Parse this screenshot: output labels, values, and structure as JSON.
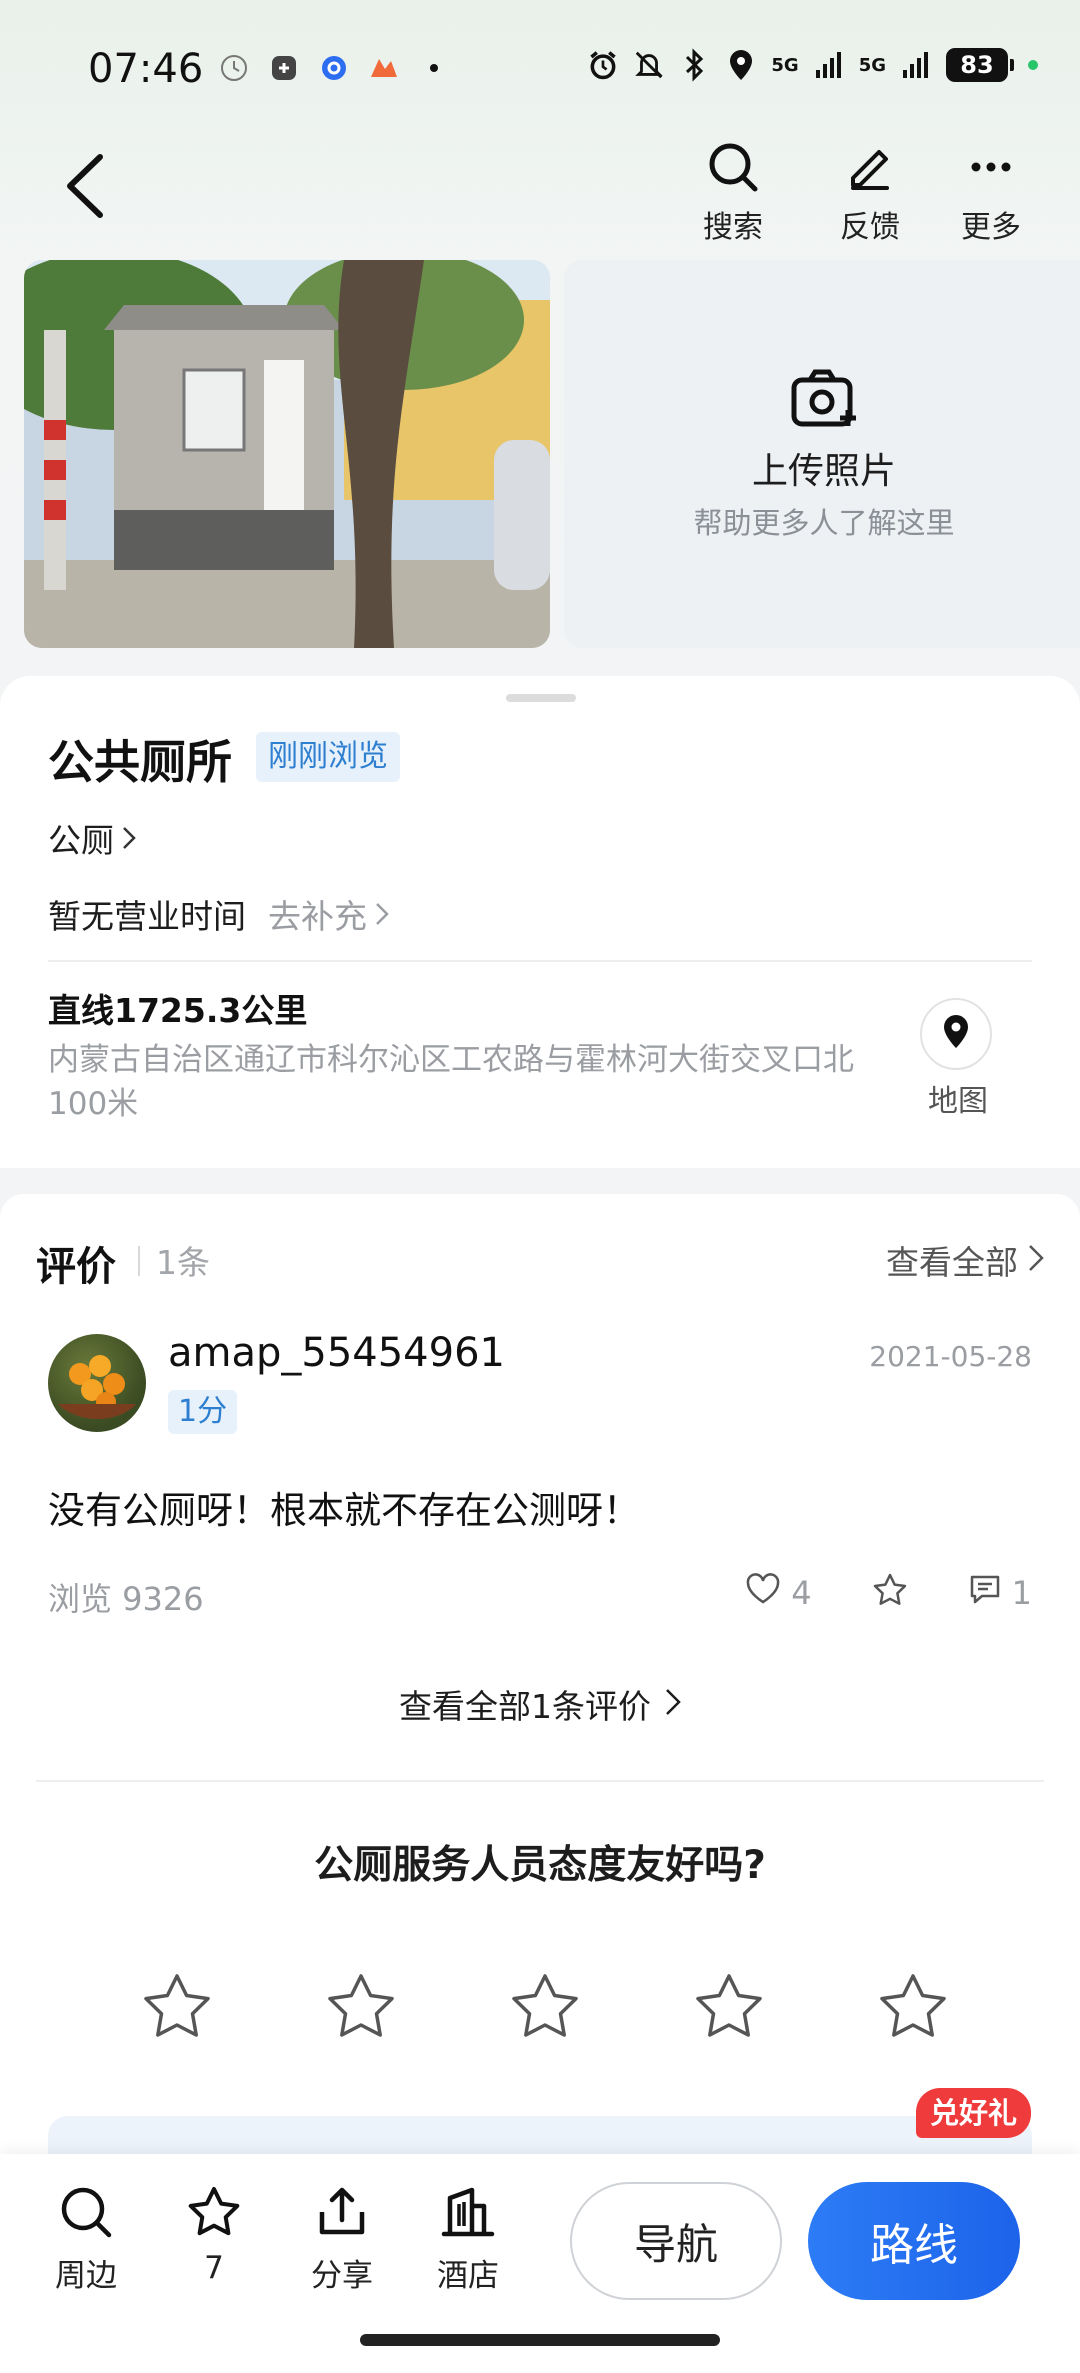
{
  "status_bar": {
    "time": "07:46",
    "signal_1": "5G",
    "signal_2": "5G",
    "battery": "83",
    "icons": [
      "clock-icon",
      "app-icon",
      "app-icon",
      "app-icon",
      "alarm-icon",
      "mute-icon",
      "bluetooth-icon",
      "location-icon"
    ]
  },
  "header": {
    "back_icon": "back-chevron-icon",
    "search_label": "搜索",
    "feedback_label": "反馈",
    "more_label": "更多"
  },
  "photos": {
    "upload_title": "上传照片",
    "upload_subtitle": "帮助更多人了解这里"
  },
  "poi": {
    "name": "公共厕所",
    "badge": "刚刚浏览",
    "category": "公厕",
    "hours": "暂无营业时间",
    "hours_action": "去补充",
    "distance": "直线1725.3公里",
    "address": "内蒙古自治区通辽市科尔沁区工农路与霍林河大街交叉口北100米",
    "map_label": "地图"
  },
  "reviews": {
    "title": "评价",
    "count": "1条",
    "view_all": "查看全部",
    "item": {
      "user": "amap_55454961",
      "score": "1分",
      "date": "2021-05-28",
      "text": "没有公厕呀！根本就不存在公测呀！",
      "views": "浏览 9326",
      "likes": "4",
      "comments": "1"
    },
    "view_all_reviews": "查看全部1条评价",
    "question": "公厕服务人员态度友好吗?",
    "rating_max": 5,
    "rating_value": 0,
    "gift_badge": "兑好礼"
  },
  "bottom_bar": {
    "nearby": "周边",
    "favorites": "7",
    "share": "分享",
    "hotel": "酒店",
    "navigate": "导航",
    "route": "路线"
  },
  "colors": {
    "accent": "#1c63ea",
    "badge_bg": "#e6f1fb",
    "badge_text": "#2f7fd0",
    "gift_red": "#ef3b3b"
  }
}
